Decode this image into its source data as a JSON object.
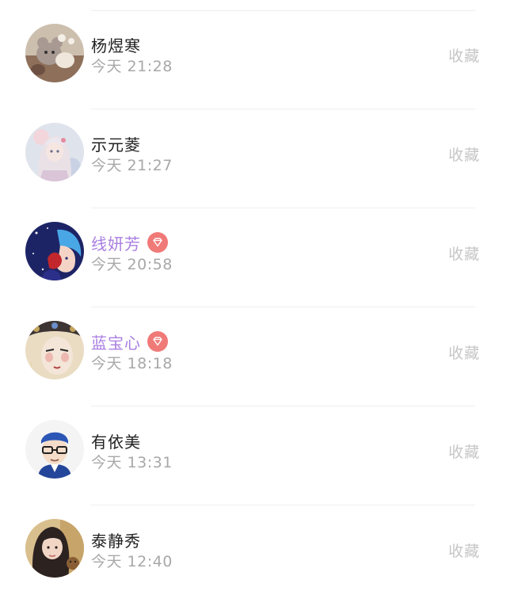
{
  "collect_label": "收藏",
  "items": [
    {
      "name": "杨煜寒",
      "time": "今天 21:28",
      "vip": false,
      "avatar": "avatar-plush-toys-icon"
    },
    {
      "name": "示元菱",
      "time": "今天 21:27",
      "vip": false,
      "avatar": "avatar-anime-girl-pink-icon"
    },
    {
      "name": "线妍芳",
      "time": "今天 20:58",
      "vip": true,
      "avatar": "avatar-anime-blue-hair-icon"
    },
    {
      "name": "蓝宝心",
      "time": "今天 18:18",
      "vip": true,
      "avatar": "avatar-opera-face-icon"
    },
    {
      "name": "有依美",
      "time": "今天 13:31",
      "vip": false,
      "avatar": "avatar-cartoon-boy-glasses-icon"
    },
    {
      "name": "泰静秀",
      "time": "今天 12:40",
      "vip": false,
      "avatar": "avatar-girl-photo-icon"
    }
  ],
  "colors": {
    "vip_name": "#a97ee0",
    "vip_badge": "#f07a78",
    "time": "#a8a8a8",
    "collect": "#c6c6c6"
  }
}
